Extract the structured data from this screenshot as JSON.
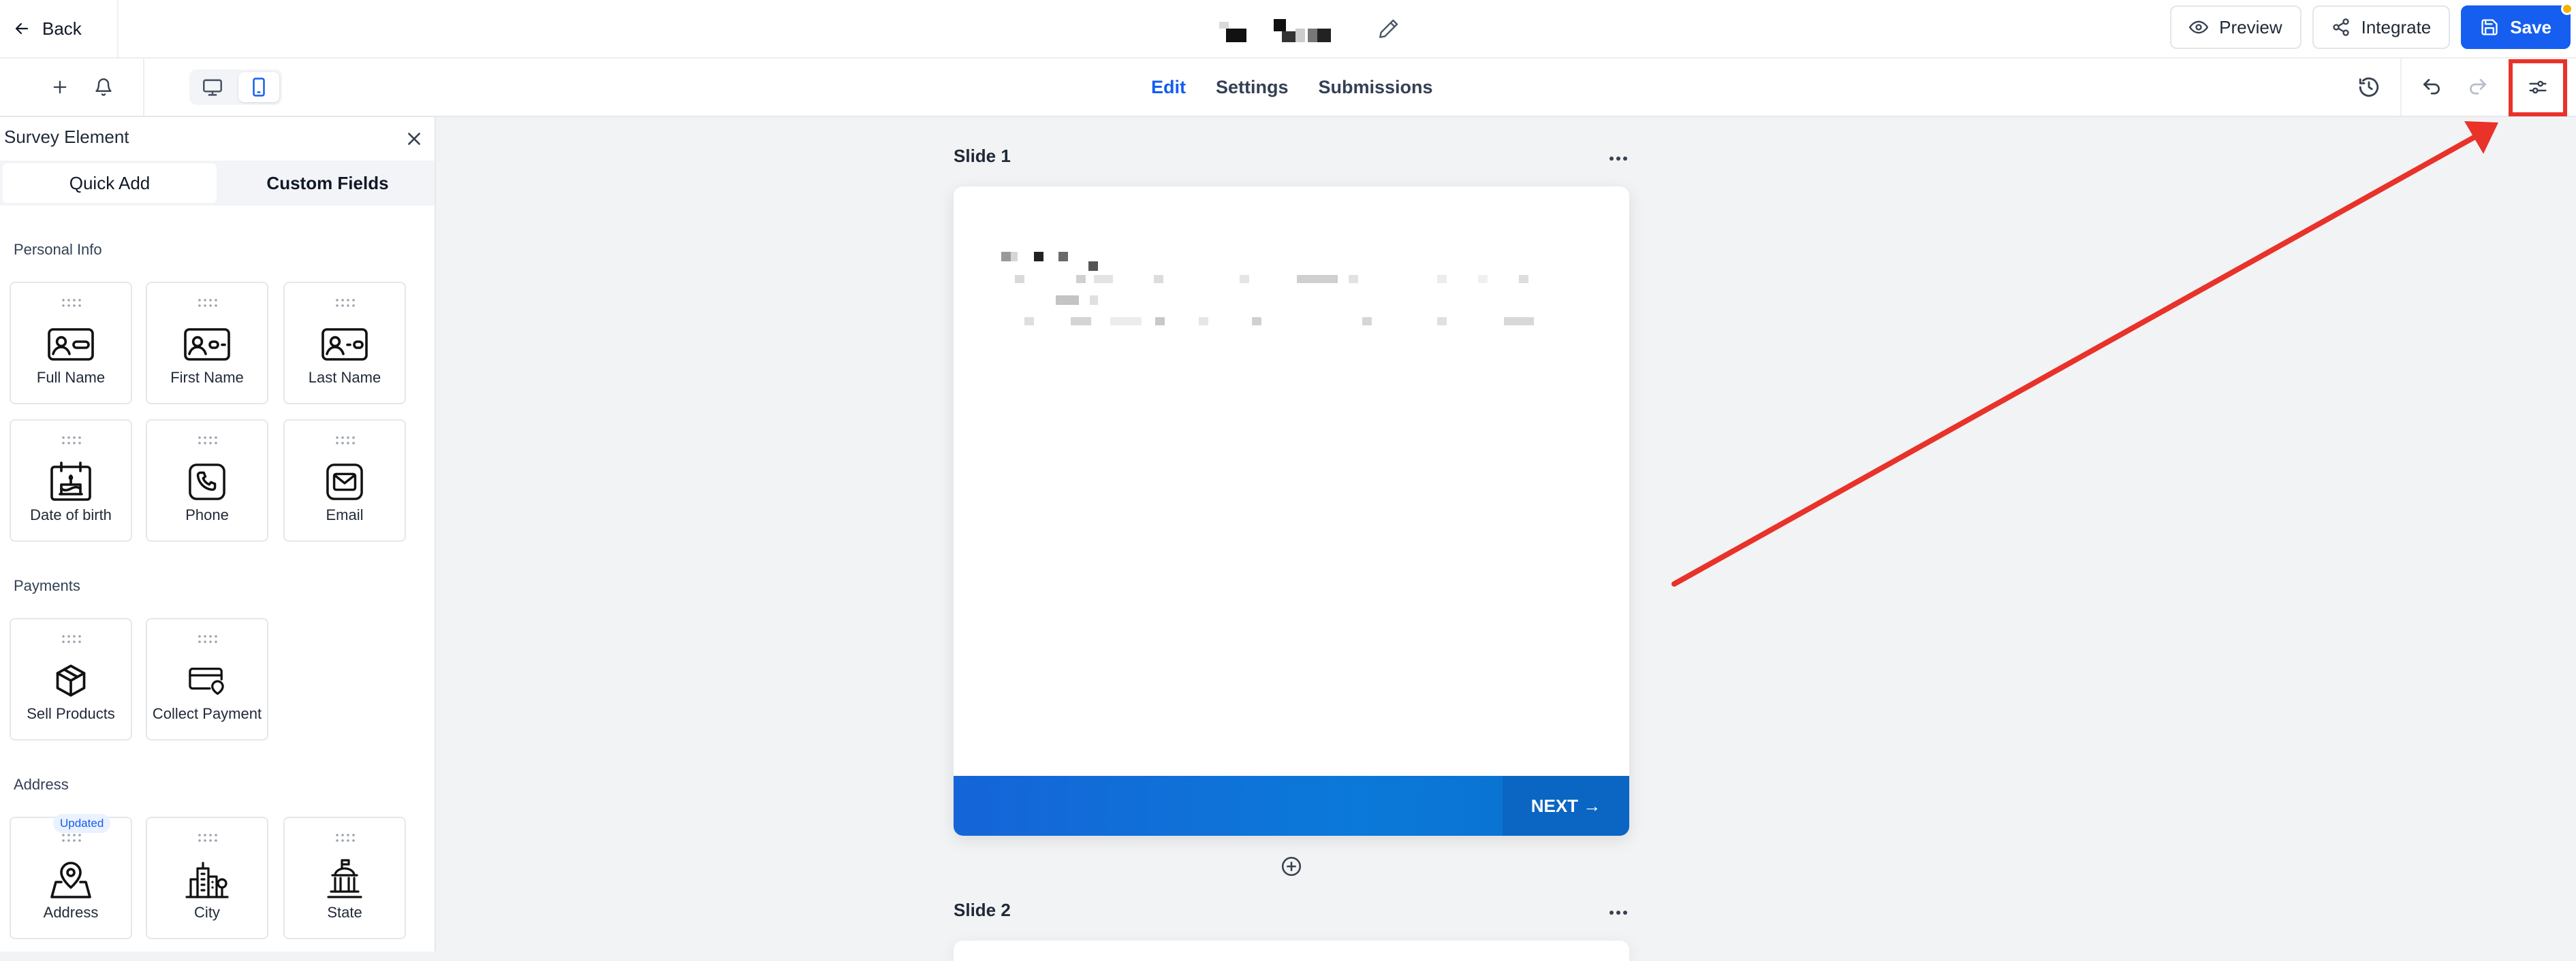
{
  "header": {
    "back_label": "Back",
    "preview_label": "Preview",
    "integrate_label": "Integrate",
    "save_label": "Save"
  },
  "toolbar": {
    "tabs": [
      {
        "label": "Edit",
        "active": true
      },
      {
        "label": "Settings",
        "active": false
      },
      {
        "label": "Submissions",
        "active": false
      }
    ],
    "device_mode": "mobile"
  },
  "sidebar": {
    "title": "Survey Element",
    "tabs": [
      {
        "label": "Quick Add",
        "active": true
      },
      {
        "label": "Custom Fields",
        "active": false
      }
    ],
    "sections": [
      {
        "title": "Personal Info",
        "items": [
          {
            "label": "Full Name",
            "icon": "id-card-icon"
          },
          {
            "label": "First Name",
            "icon": "id-card-icon"
          },
          {
            "label": "Last Name",
            "icon": "id-card-icon"
          },
          {
            "label": "Date of birth",
            "icon": "birthday-cake-calendar-icon"
          },
          {
            "label": "Phone",
            "icon": "phone-icon"
          },
          {
            "label": "Email",
            "icon": "email-icon"
          }
        ]
      },
      {
        "title": "Payments",
        "items": [
          {
            "label": "Sell Products",
            "icon": "box-icon"
          },
          {
            "label": "Collect Payment",
            "icon": "credit-card-icon"
          }
        ]
      },
      {
        "title": "Address",
        "items": [
          {
            "label": "Address",
            "icon": "map-pin-icon",
            "badge": "Updated"
          },
          {
            "label": "City",
            "icon": "city-icon"
          },
          {
            "label": "State",
            "icon": "capitol-building-icon"
          }
        ]
      }
    ]
  },
  "canvas": {
    "slides": [
      {
        "label": "Slide 1",
        "next_label": "NEXT →"
      },
      {
        "label": "Slide 2"
      }
    ]
  },
  "colors": {
    "accent": "#155eef",
    "slide_footer": "#0a66c2",
    "annotation": "#e8322a"
  }
}
